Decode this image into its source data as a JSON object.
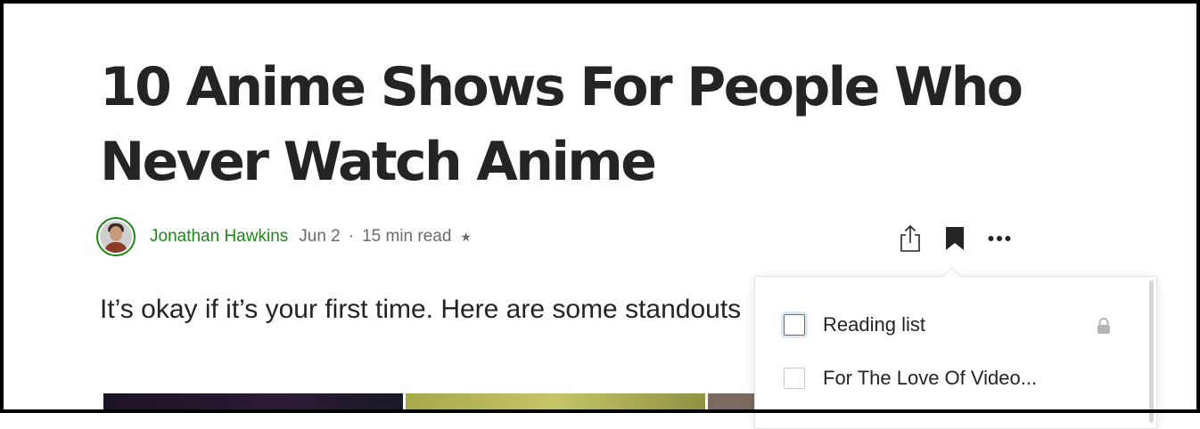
{
  "article": {
    "title": "10 Anime Shows For People Who Never Watch Anime",
    "subtitle": "It’s okay if it’s your first time. Here are some standouts"
  },
  "byline": {
    "author": "Jonathan Hawkins",
    "date": "Jun 2",
    "separator": "·",
    "read_time": "15 min read",
    "member_star": "★"
  },
  "actions": {
    "share_icon": "share-icon",
    "save_icon": "bookmark-filled-icon",
    "more_icon": "more-horizontal-icon"
  },
  "save_popup": {
    "lists": [
      {
        "label": "Reading list",
        "checked": false,
        "private": true
      },
      {
        "label": "For The Love Of Video...",
        "checked": false,
        "private": false
      }
    ]
  },
  "colors": {
    "accent_green": "#1a8917",
    "text": "#242424",
    "muted": "#6b6b6b"
  }
}
